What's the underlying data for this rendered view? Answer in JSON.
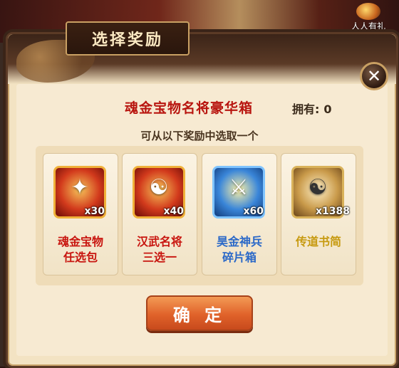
{
  "corner_badge": {
    "label": "人人有礼",
    "icon": "treasure-chest-icon"
  },
  "dialog": {
    "title": "选择奖励",
    "close_icon": "close-icon",
    "box_name": "魂金宝物名将豪华箱",
    "owned_label": "拥有:",
    "owned_count": "0",
    "subtitle": "可从以下奖励中选取一个",
    "rewards": [
      {
        "name_line1": "魂金宝物",
        "name_line2": "任选包",
        "count": "x30",
        "name_color": "#c8150f",
        "icon": "treasure-pack-icon"
      },
      {
        "name_line1": "汉武名将",
        "name_line2": "三选一",
        "count": "x40",
        "name_color": "#c8150f",
        "icon": "general-portrait-icon"
      },
      {
        "name_line1": "昊金神兵",
        "name_line2": "碎片箱",
        "count": "x60",
        "name_color": "#2a68c8",
        "icon": "weapon-shard-icon"
      },
      {
        "name_line1": "传道书简",
        "name_line2": "",
        "count": "x1388",
        "name_color": "#c79a10",
        "icon": "scroll-icon"
      }
    ],
    "confirm_label": "确 定"
  },
  "colors": {
    "accent_red": "#b8150f",
    "button_orange": "#e0622a",
    "frame_brown": "#5b3a26",
    "parchment": "#f3e3c3"
  }
}
